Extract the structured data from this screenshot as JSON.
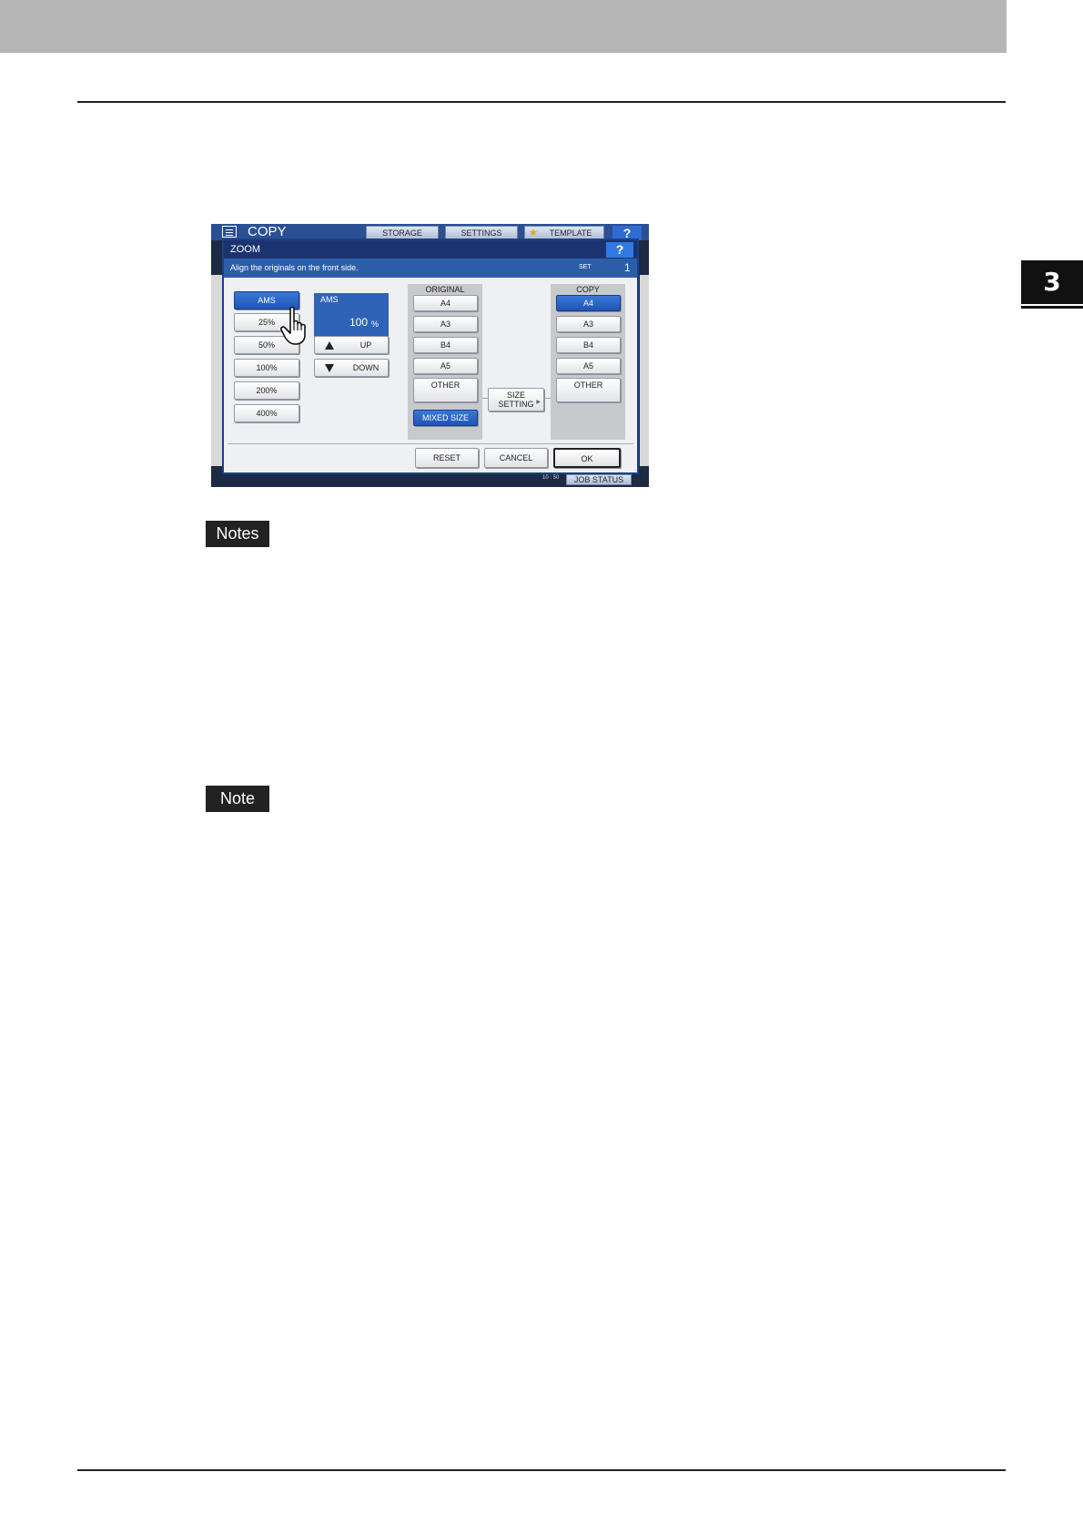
{
  "chapter": {
    "number": "3"
  },
  "labels": {
    "notes": "Notes",
    "note": "Note"
  },
  "screen": {
    "app_title": "COPY",
    "tabs": {
      "storage": "STORAGE",
      "settings": "SETTINGS",
      "template": "TEMPLATE",
      "help": "?"
    },
    "status": {
      "clock": "10 : 50",
      "job_status": "JOB STATUS"
    },
    "dialog": {
      "title": "ZOOM",
      "help": "?",
      "message": "Align the originals on the front side.",
      "set_label": "SET",
      "set_value": "1",
      "zoom_buttons": [
        "AMS",
        "25%",
        "50%",
        "100%",
        "200%",
        "400%"
      ],
      "ams_display": {
        "label": "AMS",
        "value": "100",
        "unit": "%"
      },
      "up_label": "UP",
      "down_label": "DOWN",
      "original": {
        "header": "ORIGINAL",
        "sizes": [
          "A4",
          "A3",
          "B4",
          "A5"
        ],
        "other": "OTHER",
        "mixed": "MIXED SIZE"
      },
      "size_setting": {
        "line1": "SIZE",
        "line2": "SETTING"
      },
      "copy": {
        "header": "COPY",
        "sizes": [
          "A4",
          "A3",
          "B4",
          "A5"
        ],
        "other": "OTHER"
      },
      "footer": {
        "reset": "RESET",
        "cancel": "CANCEL",
        "ok": "OK"
      }
    }
  },
  "colors": {
    "dialog_accent": "#1b3470",
    "selected": "#2f63b7",
    "chapter_tab": "#111111"
  }
}
